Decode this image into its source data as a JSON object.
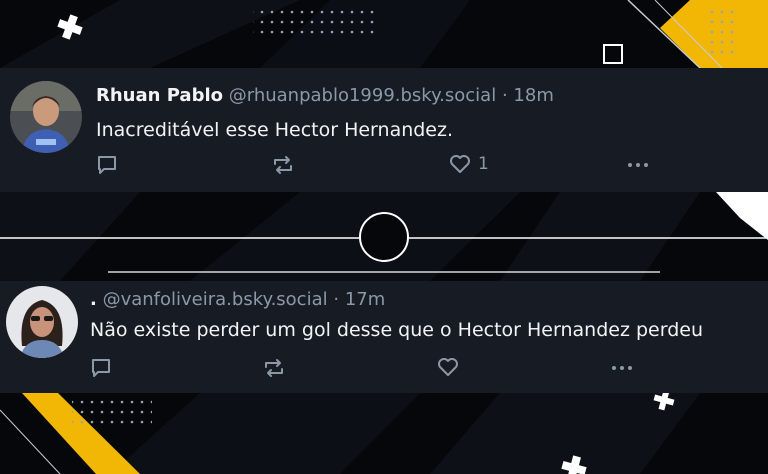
{
  "posts": [
    {
      "display_name": "Rhuan Pablo",
      "handle": "@rhuanpablo1999.bsky.social",
      "separator": "·",
      "time": "18m",
      "text": "Inacreditável esse Hector Hernandez.",
      "like_count": "1",
      "avatar_icon": "user-avatar-icon"
    },
    {
      "display_name": ".",
      "handle": "@vanfoliveira.bsky.social",
      "separator": "·",
      "time": "17m",
      "text": "Não existe perder um gol desse que o Hector Hernandez perdeu",
      "like_count": "",
      "avatar_icon": "user-avatar-icon"
    }
  ],
  "icons": {
    "reply": "reply-icon",
    "repost": "repost-icon",
    "like": "heart-icon",
    "more": "more-dots-icon"
  },
  "colors": {
    "background": "#05070b",
    "card": "#171c24",
    "accent_yellow": "#f2b705",
    "text_primary": "#f1f3f5",
    "text_secondary": "#8b98a8"
  }
}
